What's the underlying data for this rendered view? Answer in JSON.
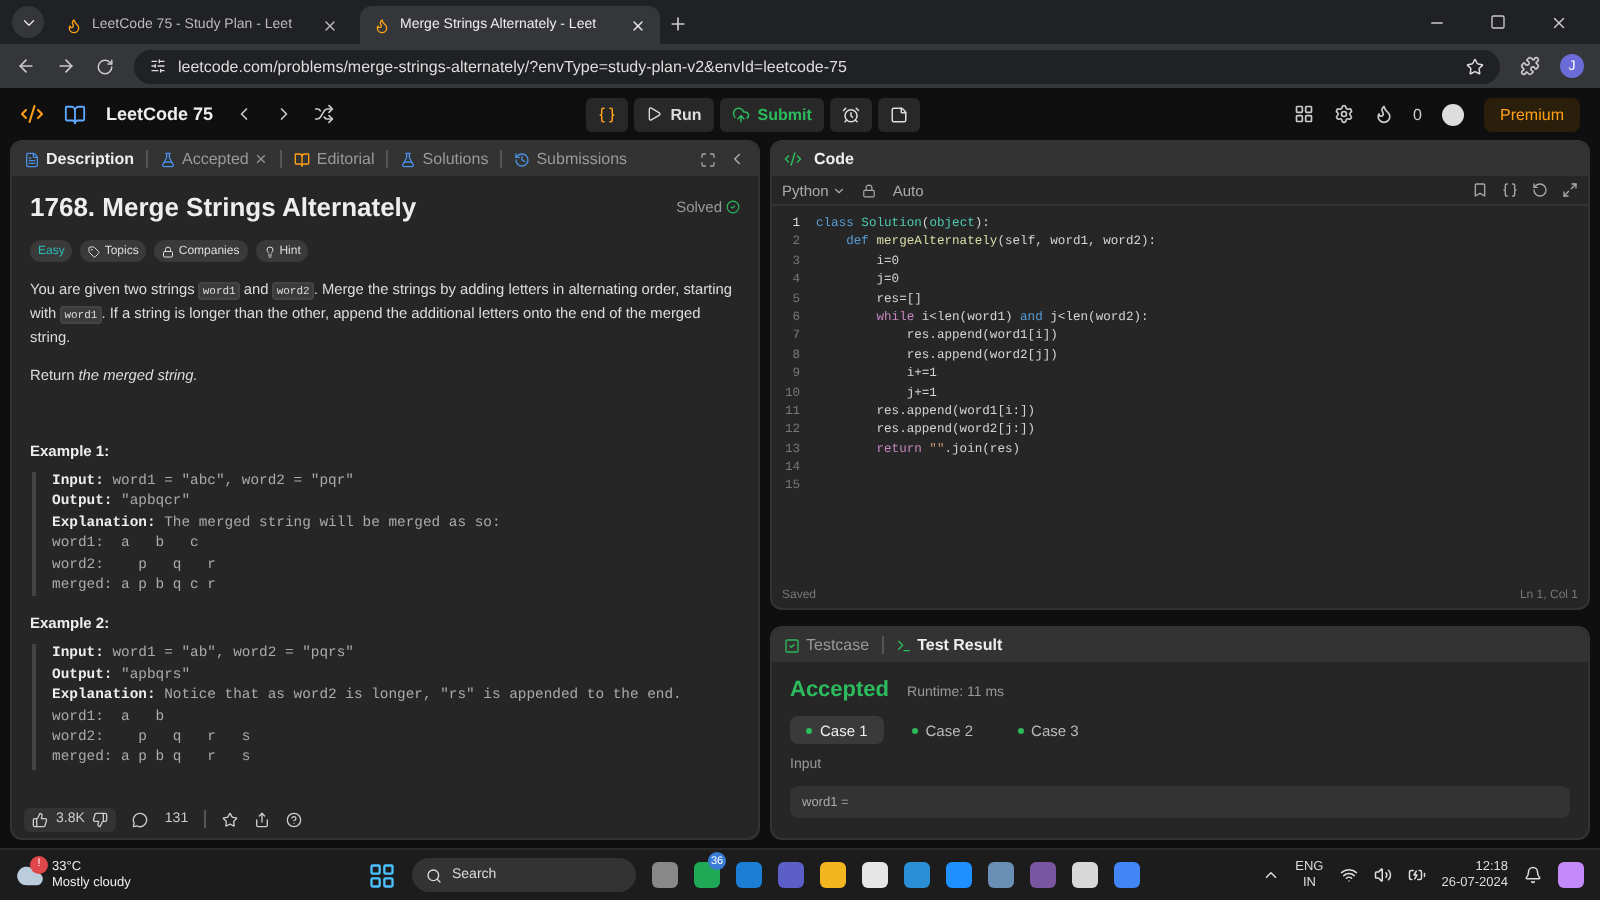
{
  "browser": {
    "tabs": [
      {
        "title": "LeetCode 75 - Study Plan - Leet",
        "selected": false
      },
      {
        "title": "Merge Strings Alternately - Leet",
        "selected": true
      }
    ],
    "url": "leetcode.com/problems/merge-strings-alternately/?envType=study-plan-v2&envId=leetcode-75",
    "profile": "J"
  },
  "nav": {
    "title": "LeetCode 75",
    "run": "Run",
    "submit": "Submit",
    "streak": "0",
    "premium": "Premium"
  },
  "description_panel": {
    "tabs": [
      {
        "label": "Description",
        "selected": true,
        "closable": false
      },
      {
        "label": "Accepted",
        "selected": false,
        "closable": true
      },
      {
        "label": "Editorial",
        "selected": false,
        "closable": false
      },
      {
        "label": "Solutions",
        "selected": false,
        "closable": false
      },
      {
        "label": "Submissions",
        "selected": false,
        "closable": false
      }
    ],
    "title": "1768. Merge Strings Alternately",
    "status": "Solved",
    "tags": [
      {
        "label": "Easy",
        "kind": "difficulty"
      },
      {
        "label": "Topics",
        "kind": "topics"
      },
      {
        "label": "Companies",
        "kind": "companies"
      },
      {
        "label": "Hint",
        "kind": "hint"
      }
    ],
    "statement": [
      {
        "kind": "text",
        "text": "You are given two strings "
      },
      {
        "kind": "code",
        "text": "word1"
      },
      {
        "kind": "text",
        "text": " and "
      },
      {
        "kind": "code",
        "text": "word2"
      },
      {
        "kind": "text",
        "text": ". Merge the strings by adding letters in alternating order, starting with "
      },
      {
        "kind": "code",
        "text": "word1"
      },
      {
        "kind": "text",
        "text": ". If a string is longer than the other, append the additional letters onto the end of the merged string."
      }
    ],
    "return_text": "Return *the merged string.*",
    "examples": [
      {
        "title": "Example 1:",
        "lines": [
          {
            "label": "Input:",
            "text": " word1 = \"abc\", word2 = \"pqr\""
          },
          {
            "label": "Output:",
            "text": " \"apbqcr\""
          },
          {
            "label": "Explanation:",
            "text": " The merged string will be merged as so:"
          },
          {
            "text": "word1:  a   b   c"
          },
          {
            "text": "word2:    p   q   r"
          },
          {
            "text": "merged: a p b q c r"
          }
        ]
      },
      {
        "title": "Example 2:",
        "lines": [
          {
            "label": "Input:",
            "text": " word1 = \"ab\", word2 = \"pqrs\""
          },
          {
            "label": "Output:",
            "text": " \"apbqrs\""
          },
          {
            "label": "Explanation:",
            "text": " Notice that as word2 is longer, \"rs\" is appended to the end."
          },
          {
            "text": "word1:  a   b"
          },
          {
            "text": "word2:    p   q   r   s"
          },
          {
            "text": "merged: a p b q   r   s"
          }
        ]
      }
    ],
    "likes": "3.8K",
    "comments": "131"
  },
  "code_panel": {
    "title": "Code",
    "language": "Python",
    "mode": "Auto",
    "lines": [
      {
        "number": "1",
        "tokens": [
          {
            "kind": "keyword",
            "text": "class"
          },
          {
            "kind": "type",
            "text": " Solution"
          },
          {
            "kind": "plain",
            "text": "("
          },
          {
            "kind": "type",
            "text": "object"
          },
          {
            "kind": "plain",
            "text": "):"
          }
        ]
      },
      {
        "number": "2",
        "tokens": [
          {
            "kind": "keyword",
            "text": "    def"
          },
          {
            "kind": "function",
            "text": " mergeAlternately"
          },
          {
            "kind": "plain",
            "text": "(self, word1, word2):"
          }
        ]
      },
      {
        "number": "3",
        "tokens": [
          {
            "kind": "plain",
            "text": "        i=0"
          }
        ]
      },
      {
        "number": "4",
        "tokens": [
          {
            "kind": "plain",
            "text": "        j=0"
          }
        ]
      },
      {
        "number": "5",
        "tokens": [
          {
            "kind": "plain",
            "text": "        res=[]"
          }
        ]
      },
      {
        "number": "6",
        "tokens": [
          {
            "kind": "control",
            "text": "        while"
          },
          {
            "kind": "plain",
            "text": " i<len(word1) "
          },
          {
            "kind": "keyword",
            "text": "and"
          },
          {
            "kind": "plain",
            "text": " j<len(word2):"
          }
        ]
      },
      {
        "number": "7",
        "tokens": [
          {
            "kind": "plain",
            "text": "            res.append(word1[i])"
          }
        ]
      },
      {
        "number": "8",
        "tokens": [
          {
            "kind": "plain",
            "text": "            res.append(word2[j])"
          }
        ]
      },
      {
        "number": "9",
        "tokens": [
          {
            "kind": "plain",
            "text": "            i+=1"
          }
        ]
      },
      {
        "number": "10",
        "tokens": [
          {
            "kind": "plain",
            "text": "            j+=1"
          }
        ]
      },
      {
        "number": "11",
        "tokens": [
          {
            "kind": "plain",
            "text": "        res.append(word1[i:])"
          }
        ]
      },
      {
        "number": "12",
        "tokens": [
          {
            "kind": "plain",
            "text": "        res.append(word2[j:])"
          }
        ]
      },
      {
        "number": "13",
        "tokens": [
          {
            "kind": "control",
            "text": "        return"
          },
          {
            "kind": "string",
            "text": " \"\""
          },
          {
            "kind": "plain",
            "text": ".join(res)"
          }
        ]
      },
      {
        "number": "14"
      },
      {
        "number": "15"
      }
    ],
    "save_status": "Saved",
    "cursor": "Ln 1, Col 1"
  },
  "test_panel": {
    "tabs": [
      {
        "label": "Testcase",
        "selected": false
      },
      {
        "label": "Test Result",
        "selected": true
      }
    ],
    "verdict": "Accepted",
    "runtime": "Runtime: 11 ms",
    "cases": [
      {
        "label": "Case 1",
        "selected": true
      },
      {
        "label": "Case 2",
        "selected": false
      },
      {
        "label": "Case 3",
        "selected": false
      }
    ],
    "input_label": "Input",
    "input_value": "word1 ="
  },
  "taskbar": {
    "temperature": "33°C",
    "weather": "Mostly cloudy",
    "weather_alert": "!",
    "search": "Search",
    "chat_badge": "36",
    "language": "ENG",
    "region": "IN",
    "time": "12:18",
    "date": "26-07-2024"
  }
}
